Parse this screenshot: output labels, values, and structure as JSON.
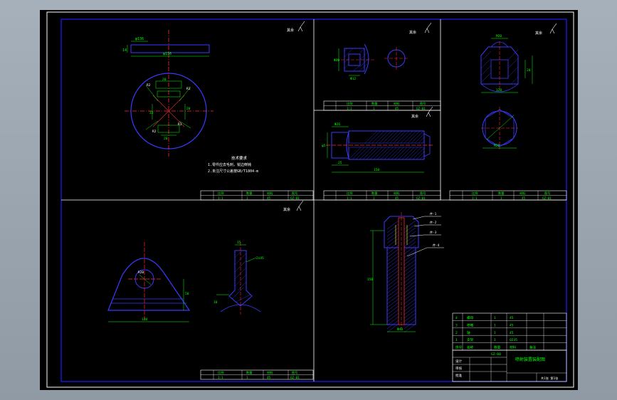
{
  "drawing": {
    "colors": {
      "background": "#000000",
      "frame": "#ffffff",
      "border": "#1a1aff",
      "outline": "#3a3aff",
      "dimension": "#00ff00",
      "centerline": "#ff2a2a",
      "hatch": "#3a3aff",
      "text": "#ffffff",
      "table_text": "#00ff00",
      "leader": "#ffffff"
    },
    "views": {
      "flange_plate": {
        "roughness": "其余",
        "thickness_dim": "14",
        "width_dim": "φ136",
        "holes_dims": [
          "R2",
          "R3",
          "R2",
          "R1",
          "20",
          "20",
          "20",
          "32"
        ],
        "notes_title": "技术要求",
        "notes": [
          "1.零件应去毛刺，锐边倒钝",
          "2.未注尺寸公差按GB/T1804-m"
        ]
      },
      "nozzle": {
        "roughness": "其余",
        "dims": [
          "Φ20",
          "Φ12"
        ]
      },
      "nut": {
        "roughness": "其余",
        "dims": [
          "120",
          "20",
          "M20"
        ]
      },
      "shaft": {
        "roughness": "其余",
        "dims": [
          "Φ26",
          "φ5",
          "25",
          "150"
        ]
      },
      "bracket": {
        "roughness": "其余",
        "dims": [
          "R20",
          "50",
          "120",
          "10",
          "2x45",
          "15"
        ]
      },
      "assembly": {
        "dims": [
          "150",
          "Φ40"
        ],
        "balloons": [
          "件-1",
          "件-2",
          "件-3",
          "件-4"
        ]
      }
    },
    "mini_tables": {
      "row1": [
        "比例",
        "数量",
        "材料",
        "图号"
      ],
      "row2": [
        "1:1",
        "1",
        "45",
        "GZ-01"
      ]
    },
    "bom": {
      "rows": [
        [
          "4",
          "螺母",
          "1",
          "45",
          ""
        ],
        [
          "3",
          "喷嘴",
          "1",
          "45",
          ""
        ],
        [
          "2",
          "轴",
          "1",
          "45",
          ""
        ],
        [
          "1",
          "支架",
          "1",
          "Q235",
          ""
        ]
      ],
      "header": [
        "序号",
        "名称",
        "数量",
        "材料",
        "备注"
      ]
    },
    "title_block": {
      "title": "喷射装置装配图",
      "drawing_no": "GZ-00",
      "labels": [
        "设计",
        "审核",
        "批准"
      ],
      "sheet": "共1张 第1张"
    }
  }
}
